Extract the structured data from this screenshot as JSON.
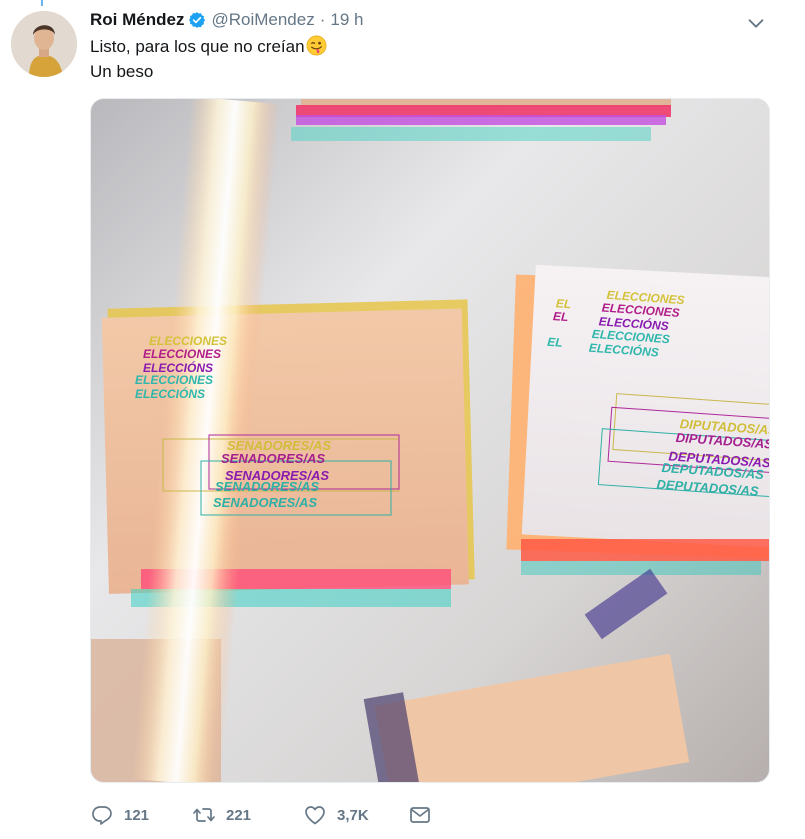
{
  "tweet": {
    "author_name": "Roi Méndez",
    "handle": "@RoiMendez",
    "separator": "·",
    "time": "19 h",
    "text_line1": "Listo, para los que no creían",
    "text_line2": "Un beso",
    "verified": true
  },
  "media": {
    "description_text": {
      "left_heading": [
        "ELECCIONES",
        "ELECCIÓNS",
        "ELECCIONES",
        "ELECCIÓNS"
      ],
      "left_box": [
        "SENADORES/AS",
        "SENADORES/AS",
        "SENADORES/AS",
        "SENADORES/AS"
      ],
      "right_heading": [
        "ELECCIONES",
        "ELECCIONES",
        "ELECCIÓNS",
        "ELECCIONES",
        "ELECCIÓNS"
      ],
      "right_box": [
        "DIPUTADOS/AS",
        "DIPUTADOS/AS",
        "DEPUTADOS/AS",
        "DEPUTADOS/AS"
      ]
    }
  },
  "actions": {
    "reply_count": "121",
    "retweet_count": "221",
    "like_count": "3,7K"
  },
  "colors": {
    "text": "#14171a",
    "secondary": "#657786",
    "verified": "#1da1f2"
  },
  "icons": [
    "verified-badge-icon",
    "chevron-down-icon",
    "reply-icon",
    "retweet-icon",
    "like-icon",
    "message-icon",
    "winking-tongue-emoji"
  ]
}
